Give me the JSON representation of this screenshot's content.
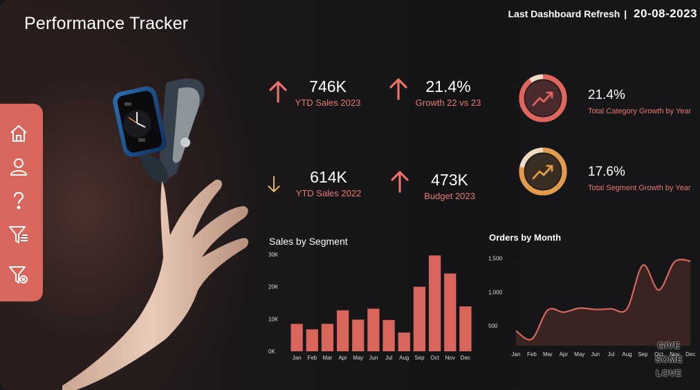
{
  "header": {
    "title": "Performance Tracker",
    "refresh_label": "Last Dashboard Refresh",
    "refresh_sep": "|",
    "refresh_date": "20-08-2023"
  },
  "sidebar": {
    "items": [
      {
        "name": "home-icon"
      },
      {
        "name": "user-icon"
      },
      {
        "name": "help-icon"
      },
      {
        "name": "filter-icon"
      },
      {
        "name": "clear-filter-icon"
      }
    ]
  },
  "kpis": {
    "ytd_2023": {
      "value": "746K",
      "label": "YTD Sales 2023",
      "trend": "up"
    },
    "growth": {
      "value": "21.4%",
      "label": "Growth 22 vs 23",
      "trend": "up"
    },
    "ytd_2022": {
      "value": "614K",
      "label": "YTD Sales 2022",
      "trend": "down"
    },
    "budget": {
      "value": "473K",
      "label": "Budget 2023",
      "trend": "up"
    }
  },
  "gauges": {
    "category": {
      "value": "21.4%",
      "label": "Total Category Growth by Year",
      "fraction": 0.9
    },
    "segment": {
      "value": "17.6%",
      "label": "Total Segment Growth by Year",
      "fraction": 0.78
    }
  },
  "colors": {
    "accent": "#d8665c",
    "label": "#e87a6f",
    "up_arrow": "#ee7267",
    "down_arrow": "#e6b86a",
    "gauge_red": "#e0655c",
    "gauge_orange": "#e39a4a"
  },
  "watermark": [
    "GIVE",
    "SOME",
    "LOVE"
  ],
  "chart_data": [
    {
      "type": "bar",
      "title": "Sales by Segment",
      "categories": [
        "Jan",
        "Feb",
        "Mar",
        "Apr",
        "May",
        "Jun",
        "Jul",
        "Aug",
        "Sep",
        "Oct",
        "Nov",
        "Dec"
      ],
      "values": [
        8500,
        6800,
        8500,
        12700,
        9800,
        13200,
        9700,
        5800,
        20000,
        29700,
        24100,
        13900
      ],
      "ylim": [
        0,
        30000
      ],
      "yticks": [
        0,
        10000,
        20000,
        30000
      ],
      "ytick_labels": [
        "0K",
        "10K",
        "20K",
        "30K"
      ],
      "xlabel": "",
      "ylabel": "",
      "grid": false
    },
    {
      "type": "area",
      "title": "Orders by Month",
      "x": [
        "Jan",
        "Feb",
        "Mar",
        "Apr",
        "May",
        "Jun",
        "Jul",
        "Aug",
        "Sep",
        "Oct",
        "Nov",
        "Dec"
      ],
      "values": [
        420,
        300,
        730,
        700,
        760,
        740,
        750,
        750,
        1400,
        1030,
        1450,
        1460
      ],
      "ylim": [
        200,
        1600
      ],
      "yticks": [
        500,
        1000,
        1500
      ],
      "ytick_labels": [
        "500",
        "1,000",
        "1,500"
      ],
      "xlabel": "",
      "ylabel": "",
      "grid": false
    }
  ]
}
